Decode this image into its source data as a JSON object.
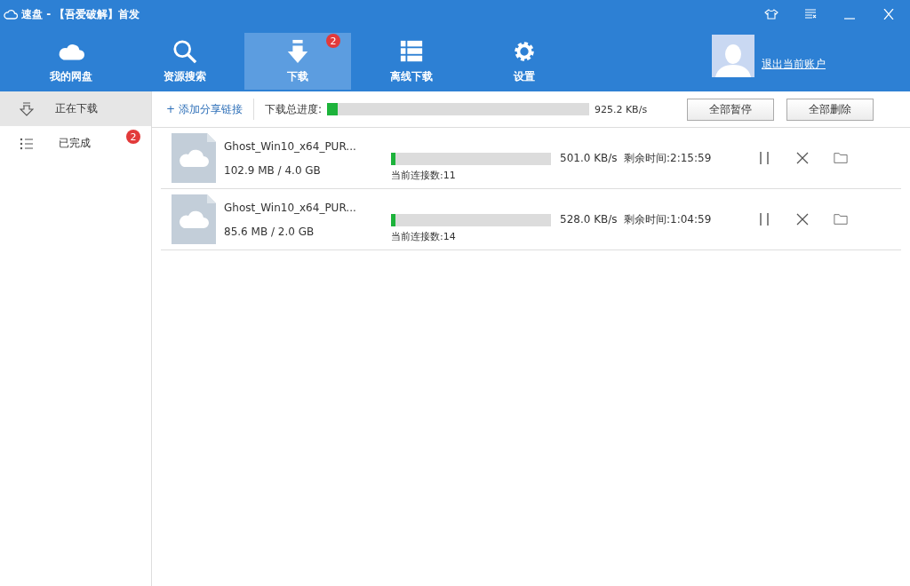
{
  "window": {
    "title": "速盘 - 【吾爱破解】首发"
  },
  "nav": [
    {
      "label": "我的网盘",
      "selected": false
    },
    {
      "label": "资源搜索",
      "selected": false
    },
    {
      "label": "下载",
      "selected": true,
      "badge": "2"
    },
    {
      "label": "离线下载",
      "selected": false
    },
    {
      "label": "设置",
      "selected": false
    }
  ],
  "account": {
    "logout": "退出当前账户"
  },
  "sidebar": {
    "items": [
      {
        "label": "正在下载",
        "selected": true
      },
      {
        "label": "已完成",
        "selected": false,
        "badge": "2"
      }
    ]
  },
  "toolbar": {
    "add_link": "+ 添加分享链接",
    "total_label": "下载总进度:",
    "total": {
      "level": 0.04
    },
    "total_speed": "925.2 KB/s",
    "buttons": [
      "全部暂停",
      "全部删除"
    ]
  },
  "downloads": [
    {
      "name": "Ghost_Win10_x64_PUR...",
      "size": "102.9 MB / 4.0 GB",
      "level": 0.03,
      "connections": "当前连接数:11",
      "speed": "501.0 KB/s",
      "remaining": "剩余时间:2:15:59"
    },
    {
      "name": "Ghost_Win10_x64_PUR...",
      "size": "85.6 MB / 2.0 GB",
      "level": 0.03,
      "connections": "当前连接数:14",
      "speed": "528.0 KB/s",
      "remaining": "剩余时间:1:04:59"
    }
  ]
}
